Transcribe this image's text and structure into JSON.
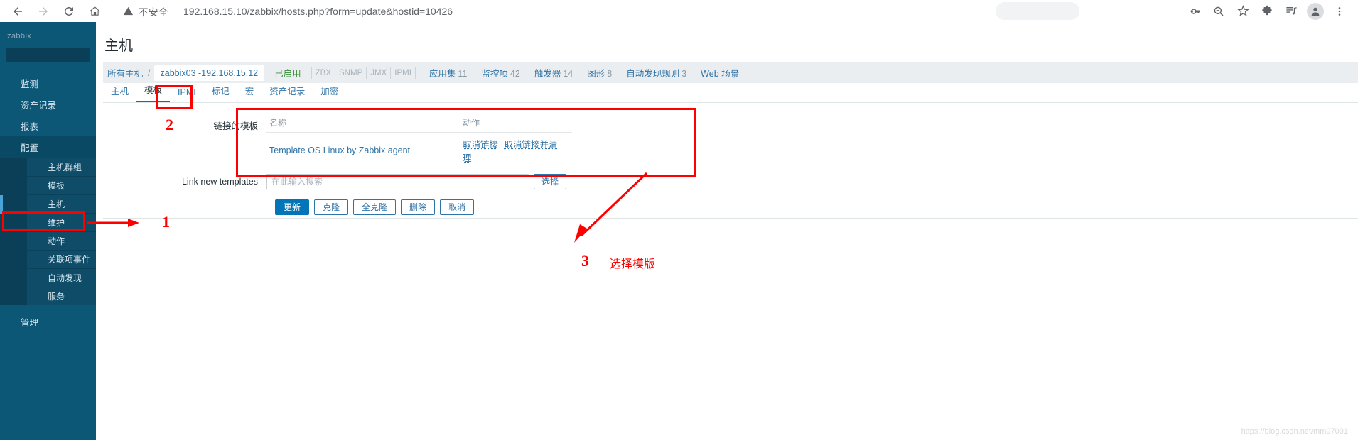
{
  "browser": {
    "back_icon": "arrow-left-icon",
    "forward_icon": "arrow-right-icon",
    "reload_icon": "reload-icon",
    "home_icon": "home-icon",
    "security_label": "不安全",
    "url": "192.168.15.10/zabbix/hosts.php?form=update&hostid=10426",
    "toolbar_icons": [
      "key-icon",
      "zoom-out-icon",
      "bookmark-star-icon",
      "extensions-puzzle-icon",
      "media-playlist-icon",
      "profile-avatar-icon",
      "kebab-menu-icon"
    ]
  },
  "sidebar": {
    "logo": "zabbix",
    "search_placeholder": "",
    "items": [
      {
        "label": "监测",
        "level": "top",
        "selected": false
      },
      {
        "label": "资产记录",
        "level": "top",
        "selected": false
      },
      {
        "label": "报表",
        "level": "top",
        "selected": false
      },
      {
        "label": "配置",
        "level": "top",
        "selected": true
      },
      {
        "label": "主机群组",
        "level": "sub",
        "active": false
      },
      {
        "label": "模板",
        "level": "sub",
        "active": false
      },
      {
        "label": "主机",
        "level": "sub",
        "active": true
      },
      {
        "label": "维护",
        "level": "sub",
        "active": false
      },
      {
        "label": "动作",
        "level": "sub",
        "active": false
      },
      {
        "label": "关联项事件",
        "level": "sub",
        "active": false
      },
      {
        "label": "自动发现",
        "level": "sub",
        "active": false
      },
      {
        "label": "服务",
        "level": "sub",
        "active": false
      },
      {
        "label": "管理",
        "level": "top",
        "selected": false
      }
    ]
  },
  "page": {
    "title": "主机"
  },
  "breadcrumb": {
    "root": "所有主机",
    "separator": "/",
    "host": "zabbix03 -192.168.15.12",
    "status": "已启用",
    "badges": [
      "ZBX",
      "SNMP",
      "JMX",
      "IPMI"
    ],
    "tabs": [
      {
        "label": "应用集",
        "count": "11"
      },
      {
        "label": "监控项",
        "count": "42"
      },
      {
        "label": "触发器",
        "count": "14"
      },
      {
        "label": "图形",
        "count": "8"
      },
      {
        "label": "自动发现规则",
        "count": "3"
      },
      {
        "label": "Web 场景",
        "count": ""
      }
    ]
  },
  "form_tabs": [
    {
      "label": "主机",
      "active": false
    },
    {
      "label": "模板",
      "active": true
    },
    {
      "label": "IPMI",
      "active": false
    },
    {
      "label": "标记",
      "active": false
    },
    {
      "label": "宏",
      "active": false
    },
    {
      "label": "资产记录",
      "active": false
    },
    {
      "label": "加密",
      "active": false
    }
  ],
  "form": {
    "linked_templates_label": "链接的模板",
    "columns": {
      "name": "名称",
      "action": "动作"
    },
    "rows": [
      {
        "name": "Template OS Linux by Zabbix agent",
        "unlink": "取消链接",
        "unlink_clear": "取消链接并清理"
      }
    ],
    "link_new_label": "Link new templates",
    "search_placeholder": "在此输入搜索",
    "search_value": "",
    "select_button": "选择",
    "buttons": [
      {
        "label": "更新",
        "primary": true
      },
      {
        "label": "克隆",
        "primary": false
      },
      {
        "label": "全克隆",
        "primary": false
      },
      {
        "label": "删除",
        "primary": false
      },
      {
        "label": "取消",
        "primary": false
      }
    ]
  },
  "annotations": {
    "step1": "1",
    "step2": "2",
    "step3": "3",
    "step3_text": "选择模版",
    "color": "#ff0000"
  },
  "watermark": "https://blog.csdn.net/mm97091"
}
